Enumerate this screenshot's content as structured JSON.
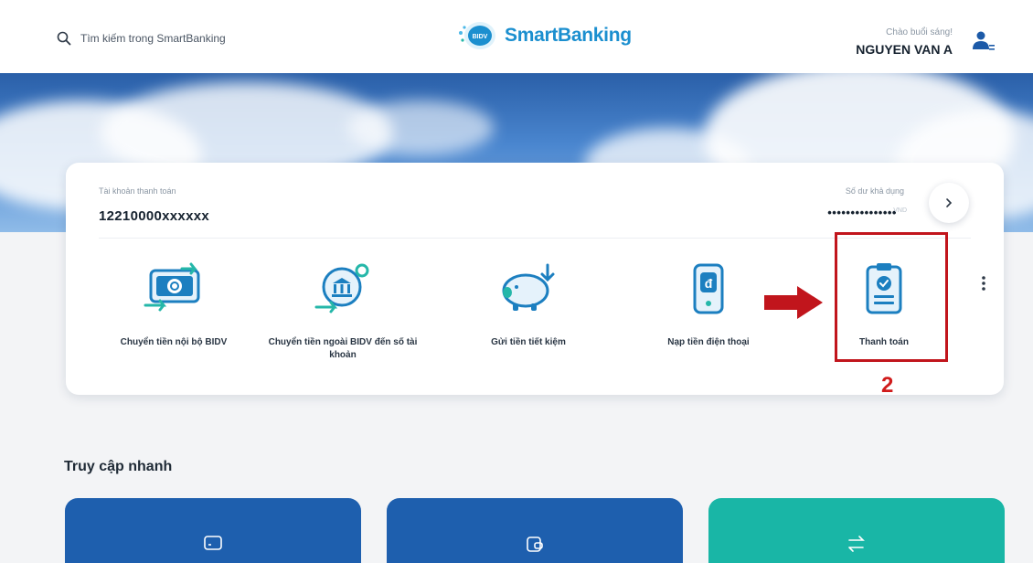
{
  "header": {
    "search_placeholder": "Tìm kiếm trong SmartBanking",
    "search_icon": "search-icon",
    "logo_badge": "BIDV",
    "logo_text": "SmartBanking",
    "greeting": "Chào buổi sáng!",
    "user_name": "NGUYEN VAN A",
    "user_icon": "user-menu-icon"
  },
  "account": {
    "label": "Tài khoản thanh toán",
    "number": "12210000xxxxxx",
    "balance_label": "Số dư khả dụng",
    "balance_masked": "•••••••••••••••",
    "balance_unit": "VND",
    "arrow_icon": "chevron-right-icon"
  },
  "services": [
    {
      "label": "Chuyển tiền nội bộ BIDV",
      "icon": "internal-transfer-icon"
    },
    {
      "label": "Chuyển tiền ngoài BIDV đến số tài khoản",
      "icon": "external-transfer-icon"
    },
    {
      "label": "Gửi tiền tiết kiệm",
      "icon": "savings-piggy-icon"
    },
    {
      "label": "Nạp tiền điện thoại",
      "icon": "phone-topup-icon"
    },
    {
      "label": "Thanh toán",
      "icon": "payment-clipboard-icon"
    }
  ],
  "more_icon": "more-vertical-icon",
  "annotation": {
    "step": "2",
    "highlight_color": "#c1151c"
  },
  "quick_access": {
    "title": "Truy cập nhanh",
    "tiles": [
      {
        "icon": "card-icon",
        "color": "#1e5fae"
      },
      {
        "icon": "wallet-icon",
        "color": "#1e5fae"
      },
      {
        "icon": "transfer-arrows-icon",
        "color": "#19b6a6"
      }
    ]
  },
  "colors": {
    "brand_blue": "#1b8fcf",
    "icon_blue": "#1c7fc0",
    "icon_teal": "#25b7a9"
  }
}
